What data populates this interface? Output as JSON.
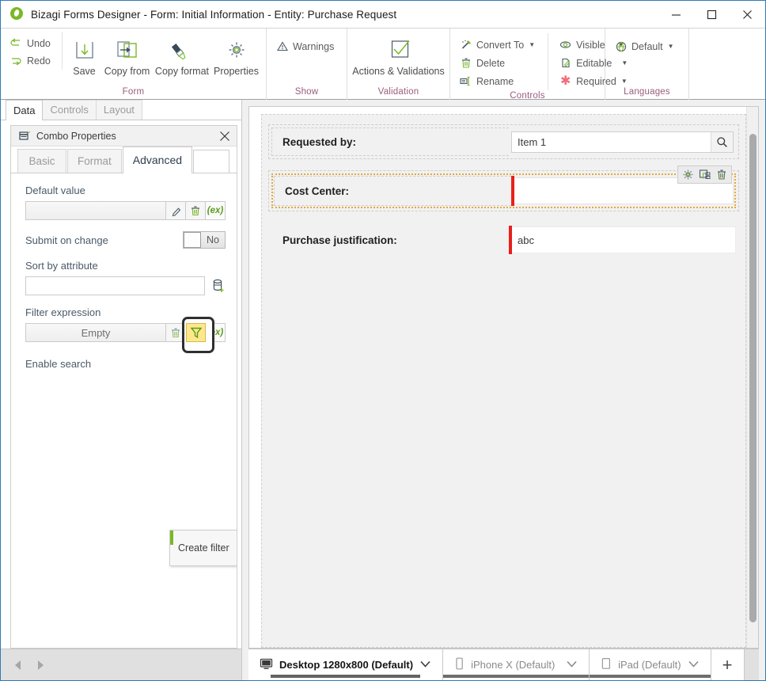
{
  "window": {
    "title": "Bizagi Forms Designer  - Form: Initial Information - Entity:  Purchase Request",
    "logo_icon": "bizagi-logo-icon",
    "minimize_label": "minimize-icon",
    "maximize_label": "maximize-icon",
    "close_label": "close-icon"
  },
  "ribbon": {
    "groups": [
      {
        "name": "form",
        "label": "Form",
        "small_buttons": [
          {
            "label": "Undo",
            "icon": "undo-icon"
          },
          {
            "label": "Redo",
            "icon": "redo-icon"
          }
        ],
        "big_buttons": [
          {
            "label": "Save",
            "icon": "save-icon"
          },
          {
            "label": "Copy from",
            "icon": "copy-from-icon"
          },
          {
            "label": "Copy format",
            "icon": "copy-format-icon"
          },
          {
            "label": "Properties",
            "icon": "gear-icon"
          }
        ]
      },
      {
        "name": "show",
        "label": "Show",
        "small_buttons": [
          {
            "label": "Warnings",
            "icon": "warning-triangle-icon"
          }
        ],
        "big_buttons": []
      },
      {
        "name": "validation",
        "label": "Validation",
        "small_buttons": [],
        "big_buttons": [
          {
            "label": "Actions & Validations",
            "icon": "checkmark-box-icon"
          }
        ]
      },
      {
        "name": "controls",
        "label": "Controls",
        "small_buttons": [
          {
            "label": "Convert To",
            "icon": "convert-to-icon",
            "dropdown": true
          },
          {
            "label": "Delete",
            "icon": "trash-icon"
          },
          {
            "label": "Rename",
            "icon": "rename-icon"
          },
          {
            "label": "Visible",
            "icon": "eye-icon",
            "dropdown": true
          },
          {
            "label": "Editable",
            "icon": "editable-pencil-icon",
            "dropdown": true
          },
          {
            "label": "Required",
            "icon": "asterisk-icon",
            "dropdown": true
          }
        ],
        "big_buttons": []
      },
      {
        "name": "languages",
        "label": "Languages",
        "small_buttons": [
          {
            "label": "Default",
            "icon": "language-globe-icon",
            "dropdown": true
          }
        ],
        "big_buttons": []
      }
    ]
  },
  "left_panel": {
    "tabs": [
      {
        "label": "Data",
        "active": true
      },
      {
        "label": "Controls",
        "active": false
      },
      {
        "label": "Layout",
        "active": false
      }
    ],
    "properties_card": {
      "icon": "combo-properties-icon",
      "title": "Combo Properties",
      "close_icon": "close-icon",
      "subtabs": [
        {
          "label": "Basic",
          "active": false
        },
        {
          "label": "Format",
          "active": false
        },
        {
          "label": "Advanced",
          "active": true
        }
      ],
      "fields": {
        "default_value": {
          "label": "Default value",
          "value": "",
          "buttons": [
            {
              "icon": "edit-pencil-icon",
              "name": "edit"
            },
            {
              "icon": "trash-icon",
              "name": "delete"
            },
            {
              "icon": "expression-icon",
              "name": "expression",
              "text": "(ex)"
            }
          ]
        },
        "submit_on_change": {
          "label": "Submit on change",
          "value": "No"
        },
        "sort_by_attribute": {
          "label": "Sort by attribute",
          "value": "",
          "placeholder": "",
          "button": {
            "icon": "add-attribute-icon",
            "name": "pick-attribute"
          }
        },
        "filter_expression": {
          "label": "Filter expression",
          "value": "Empty",
          "buttons": [
            {
              "icon": "trash-icon",
              "name": "delete"
            },
            {
              "icon": "filter-funnel-icon",
              "name": "create-filter",
              "highlighted": true
            },
            {
              "icon": "expression-icon",
              "name": "expression",
              "text": "(ex)"
            }
          ]
        },
        "enable_search": {
          "label": "Enable search"
        }
      },
      "tooltip": {
        "text": "Create filter",
        "accent_color": "#7ab828"
      }
    },
    "bottom_nav": {
      "prev_icon": "arrow-left-icon",
      "next_icon": "arrow-right-icon"
    }
  },
  "canvas": {
    "rows": [
      {
        "label": "Requested by:",
        "control_type": "search-combo",
        "value": "Item 1",
        "search_icon": "search-icon",
        "selected": false,
        "required": false
      },
      {
        "label": "Cost Center:",
        "control_type": "combo",
        "value": "",
        "selected": true,
        "required": true,
        "tools": [
          {
            "icon": "gear-icon",
            "name": "row-properties"
          },
          {
            "icon": "duplicate-icon",
            "name": "row-duplicate"
          },
          {
            "icon": "trash-icon",
            "name": "row-delete"
          }
        ]
      },
      {
        "label": "Purchase justification:",
        "control_type": "text",
        "value": "abc",
        "selected": false,
        "required": true
      }
    ],
    "scrollbar": {
      "name": "canvas-vertical-scrollbar"
    }
  },
  "device_bar": {
    "tabs": [
      {
        "label": "Desktop 1280x800 (Default)",
        "icon": "desktop-monitor-icon",
        "active": true,
        "chevron": "chevron-down-icon"
      },
      {
        "label": "iPhone X (Default)",
        "icon": "phone-icon",
        "active": false,
        "chevron": "chevron-down-icon"
      },
      {
        "label": "iPad (Default)",
        "icon": "tablet-icon",
        "active": false,
        "chevron": "chevron-down-icon"
      }
    ],
    "add_label": "+"
  },
  "colors": {
    "accent_green": "#7ab828",
    "group_label": "#9a5c7d",
    "required_red": "#e8201a",
    "selection_orange": "#e5a93c",
    "highlight_yellow": "#ffe88c",
    "window_border": "#2e7bb5"
  }
}
